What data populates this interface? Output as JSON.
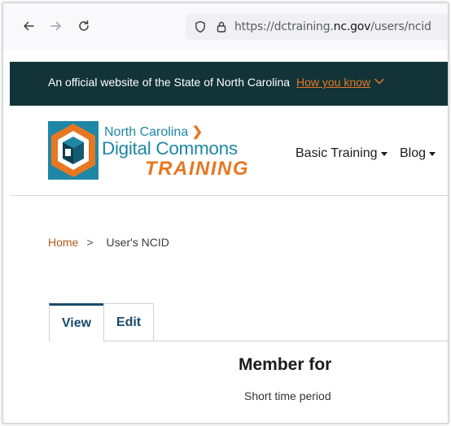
{
  "browser": {
    "url_prefix": "https://dc",
    "url_domain_sub": "training.",
    "url_domain": "nc.gov",
    "url_path": "/users/ncid"
  },
  "gov_banner": {
    "text": "An official website of the State of North Carolina",
    "link": "How you know"
  },
  "brand": {
    "line1": "North Carolina",
    "line1_arrow": "❯",
    "line2": "Digital Commons",
    "line3": "TRAINING"
  },
  "nav": {
    "items": [
      {
        "label": "Basic Training"
      },
      {
        "label": "Blog"
      }
    ]
  },
  "breadcrumb": {
    "home": "Home",
    "separator": ">",
    "current": "User's NCID"
  },
  "tabs": [
    {
      "label": "View",
      "active": true
    },
    {
      "label": "Edit",
      "active": false
    }
  ],
  "profile": {
    "member_for_label": "Member for",
    "member_for_value": "Short time period"
  },
  "colors": {
    "banner_bg": "#123438",
    "accent_orange": "#e87722",
    "brand_teal": "#1f87a6",
    "tab_blue": "#1a4a6b"
  },
  "icons": [
    "back-arrow-icon",
    "forward-arrow-icon",
    "reload-icon",
    "shield-icon",
    "lock-icon",
    "chevron-down-icon",
    "cube-logo-icon"
  ]
}
